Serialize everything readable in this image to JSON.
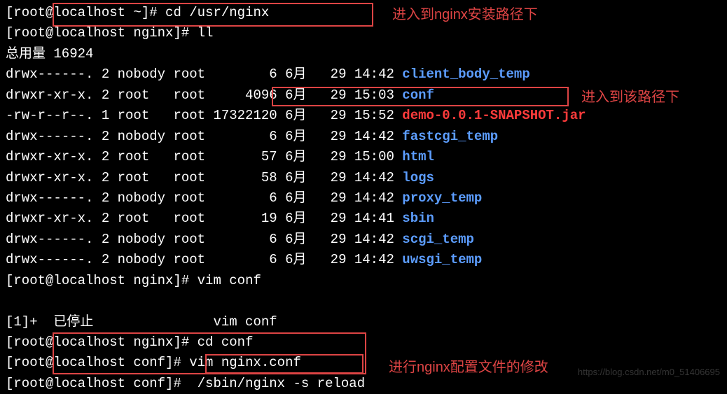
{
  "lines": {
    "l1_prompt": "[root@localhost ~]# ",
    "l1_cmd": "cd /usr/nginx",
    "l2_prompt": "[root@localhost nginx]# ",
    "l2_cmd": "ll",
    "l3": "总用量 16924",
    "rows": [
      {
        "perm": "drwx------.",
        "links": "2",
        "owner": "nobody",
        "group": "root",
        "size": "       6",
        "month": "6月",
        "day": "  29",
        "time": "14:42",
        "name": "client_body_temp",
        "cls": "blue"
      },
      {
        "perm": "drwxr-xr-x.",
        "links": "2",
        "owner": "root  ",
        "group": "root",
        "size": "    4096",
        "month": "6月",
        "day": "  29",
        "time": "15:03",
        "name": "conf",
        "cls": "blue"
      },
      {
        "perm": "-rw-r--r--.",
        "links": "1",
        "owner": "root  ",
        "group": "root",
        "size": "17322120",
        "month": "6月",
        "day": "  29",
        "time": "15:52",
        "name": "demo-0.0.1-SNAPSHOT.jar",
        "cls": "red"
      },
      {
        "perm": "drwx------.",
        "links": "2",
        "owner": "nobody",
        "group": "root",
        "size": "       6",
        "month": "6月",
        "day": "  29",
        "time": "14:42",
        "name": "fastcgi_temp",
        "cls": "blue"
      },
      {
        "perm": "drwxr-xr-x.",
        "links": "2",
        "owner": "root  ",
        "group": "root",
        "size": "      57",
        "month": "6月",
        "day": "  29",
        "time": "15:00",
        "name": "html",
        "cls": "blue"
      },
      {
        "perm": "drwxr-xr-x.",
        "links": "2",
        "owner": "root  ",
        "group": "root",
        "size": "      58",
        "month": "6月",
        "day": "  29",
        "time": "14:42",
        "name": "logs",
        "cls": "blue"
      },
      {
        "perm": "drwx------.",
        "links": "2",
        "owner": "nobody",
        "group": "root",
        "size": "       6",
        "month": "6月",
        "day": "  29",
        "time": "14:42",
        "name": "proxy_temp",
        "cls": "blue"
      },
      {
        "perm": "drwxr-xr-x.",
        "links": "2",
        "owner": "root  ",
        "group": "root",
        "size": "      19",
        "month": "6月",
        "day": "  29",
        "time": "14:41",
        "name": "sbin",
        "cls": "blue"
      },
      {
        "perm": "drwx------.",
        "links": "2",
        "owner": "nobody",
        "group": "root",
        "size": "       6",
        "month": "6月",
        "day": "  29",
        "time": "14:42",
        "name": "scgi_temp",
        "cls": "blue"
      },
      {
        "perm": "drwx------.",
        "links": "2",
        "owner": "nobody",
        "group": "root",
        "size": "       6",
        "month": "6月",
        "day": "  29",
        "time": "14:42",
        "name": "uwsgi_temp",
        "cls": "blue"
      }
    ],
    "l4_prompt": "[root@localhost nginx]# ",
    "l4_cmd": "vim conf",
    "blank": " ",
    "job": "[1]+  已停止               vim conf",
    "l5_prompt": "[root@localhost nginx]# ",
    "l5_cmd": "cd conf",
    "l6_prompt": "[root@localhost conf]# ",
    "l6_cmd": "vim nginx.conf",
    "l7_prompt": "[root@localhost conf]# ",
    "l7_cmd": " /sbin/nginx -s reload"
  },
  "annotations": {
    "a1": "进入到nginx安装路径下",
    "a2": "进入到该路径下",
    "a3": "进行nginx配置文件的修改"
  },
  "watermark": "https://blog.csdn.net/m0_51406695"
}
